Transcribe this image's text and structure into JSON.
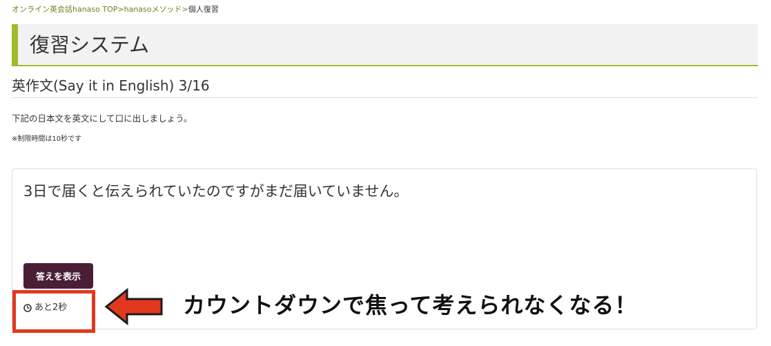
{
  "breadcrumb": {
    "items": [
      "オンライン英会話hanaso TOP",
      "hanasoメソッド",
      "個人復習"
    ],
    "separator": ">"
  },
  "header": {
    "title": "復習システム"
  },
  "section": {
    "title": "英作文(Say it in English) 3/16"
  },
  "instruction": {
    "text": "下記の日本文を英文にして口に出しましょう。",
    "note": "※制限時間は10秒です"
  },
  "question": {
    "text": "3日で届くと伝えられていたのですがまだ届いていません。",
    "show_answer_label": "答えを表示",
    "countdown_label": "あと2秒",
    "clock_icon": "clock-icon"
  },
  "annotation": {
    "text": "カウントダウンで焦って考えられなくなる！",
    "arrow_icon": "left-arrow-icon"
  },
  "colors": {
    "link": "#6e7f1a",
    "accent": "#9dbb2b",
    "header_bg": "#f2f2f2",
    "button_bg": "#4a1e34",
    "annotation_red": "#e2381f"
  }
}
